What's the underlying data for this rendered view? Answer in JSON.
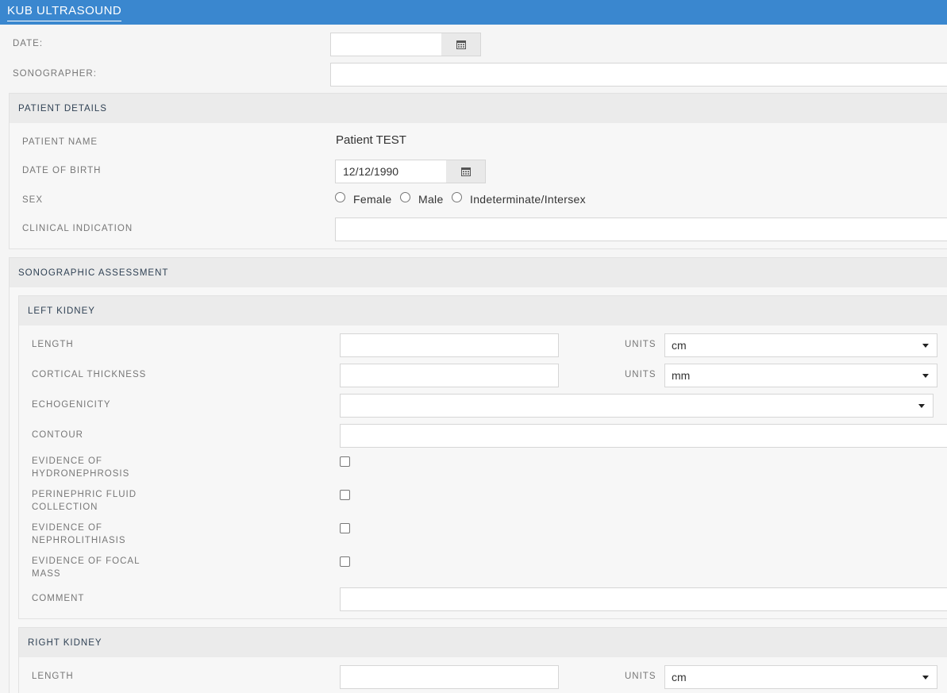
{
  "header": {
    "title": "KUB ULTRASOUND"
  },
  "form": {
    "date_label": "DATE:",
    "date_value": "",
    "sonographer_label": "SONOGRAPHER:",
    "sonographer_value": ""
  },
  "patient_details": {
    "heading": "PATIENT DETAILS",
    "name_label": "PATIENT NAME",
    "name_value": "Patient TEST",
    "dob_label": "DATE OF BIRTH",
    "dob_value": "12/12/1990",
    "sex_label": "SEX",
    "sex_options": [
      "Female",
      "Male",
      "Indeterminate/Intersex"
    ],
    "clinical_label": "CLINICAL INDICATION",
    "clinical_value": ""
  },
  "assessment": {
    "heading": "SONOGRAPHIC ASSESSMENT",
    "left_kidney": {
      "heading": "LEFT KIDNEY",
      "length_label": "LENGTH",
      "length_value": "",
      "length_units_label": "UNITS",
      "length_units_value": "cm",
      "cortical_label": "CORTICAL THICKNESS",
      "cortical_value": "",
      "cortical_units_label": "UNITS",
      "cortical_units_value": "mm",
      "echogenicity_label": "ECHOGENICITY",
      "echogenicity_value": "",
      "contour_label": "CONTOUR",
      "contour_value": "",
      "hydro_label_1": "EVIDENCE OF",
      "hydro_label_2": "HYDRONEPHROSIS",
      "peri_label_1": "PERINEPHRIC FLUID",
      "peri_label_2": "COLLECTION",
      "nephro_label_1": "EVIDENCE OF",
      "nephro_label_2": "NEPHROLITHIASIS",
      "focal_label_1": "EVIDENCE OF FOCAL",
      "focal_label_2": "MASS",
      "comment_label": "COMMENT",
      "comment_value": ""
    },
    "right_kidney": {
      "heading": "RIGHT KIDNEY",
      "length_label": "LENGTH",
      "length_value": "",
      "length_units_label": "UNITS",
      "length_units_value": "cm"
    }
  },
  "icons": {
    "calendar": "calendar-icon",
    "dropdown": "chevron-down-icon"
  }
}
